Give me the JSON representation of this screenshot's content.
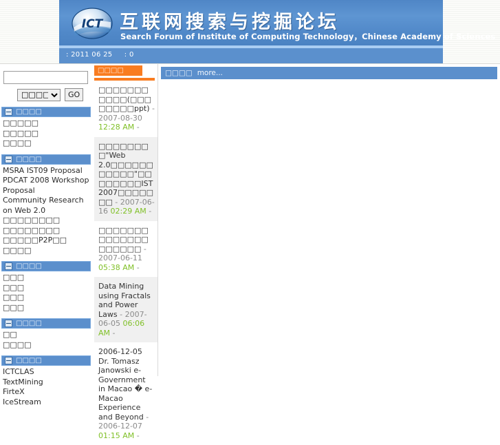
{
  "banner": {
    "logo_alt": "ICT logo",
    "logo_text": "ICT",
    "title_cn": "互联网搜索与挖掘论坛",
    "title_en": "Search Forum of Institute of Computing Technology，Chinese Academy of Sciences",
    "date_bar": ": 2011 06 25     : 0"
  },
  "search": {
    "input_value": "",
    "placeholder": "",
    "select_value": "□□□□□□",
    "go_label": "GO"
  },
  "sidebar": {
    "sections": [
      {
        "title": "□□□□",
        "items": [
          {
            "label": "□□□□□"
          },
          {
            "label": "□□□□□"
          },
          {
            "label": "□□□□"
          }
        ]
      },
      {
        "title": "□□□□",
        "items": [
          {
            "label": "MSRA IST09 Proposal"
          },
          {
            "label": "PDCAT 2008 Workshop Proposal"
          },
          {
            "label": " Community Research on Web 2.0"
          },
          {
            "label": "□□□□□□□□"
          },
          {
            "label": "□□□□□□□□"
          },
          {
            "label": "□□□□□P2P□□"
          },
          {
            "label": "□□□□"
          }
        ]
      },
      {
        "title": "□□□□",
        "items": [
          {
            "label": "□□□"
          },
          {
            "label": "□□□"
          },
          {
            "label": "□□□"
          },
          {
            "label": "□□□"
          }
        ]
      },
      {
        "title": "□□□□",
        "items": [
          {
            "label": "□□"
          },
          {
            "label": "□□□□"
          }
        ]
      },
      {
        "title": "□□□□",
        "items": [
          {
            "label": "ICTCLAS"
          },
          {
            "label": "TextMining"
          },
          {
            "label": "FirteX"
          },
          {
            "label": "IceStream"
          }
        ]
      }
    ]
  },
  "middle": {
    "header": "□□□□",
    "news": [
      {
        "title": "□□□□□□□□□□□(□□□□□□□□ppt)",
        "sep": " - ",
        "date": "2007-08-30",
        "time": "12:28 AM",
        "tail": " -"
      },
      {
        "title": "□□□□□□□□\"Web 2.0□□□□□□□□□□□\"□□□□□□□□IST 2007□□□□□□□",
        "sep": " - ",
        "date": "2007-06-16",
        "time": "02:29 AM",
        "tail": " -"
      },
      {
        "title": "□□□□□□□□□□□□□□□□□□□□",
        "sep": " - ",
        "date": "2007-06-11",
        "time": "05:38 AM",
        "tail": " -"
      },
      {
        "title": "Data Mining using Fractals and Power Laws",
        "sep": " - ",
        "date": "2007-06-05",
        "time": "06:06 AM",
        "tail": " -"
      },
      {
        "title": "2006-12-05 Dr. Tomasz Janowski e-Government in Macao � e-Macao Experience and Beyond",
        "sep": " - ",
        "date": "2006-12-07",
        "time": "01:15 AM",
        "tail": " -"
      }
    ]
  },
  "right": {
    "header": "□□□□",
    "more_label": "more..."
  },
  "colors": {
    "banner_blue": "#5b90cd",
    "nav_head_blue": "#5b8fcc",
    "accent_orange": "#f97c20",
    "time_green": "#80c028",
    "date_gray": "#8a8a8a"
  }
}
